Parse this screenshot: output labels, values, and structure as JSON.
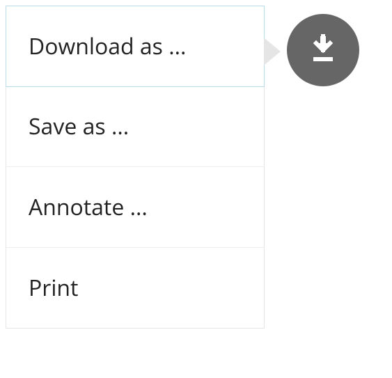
{
  "menu": {
    "items": [
      {
        "label": "Download as ..."
      },
      {
        "label": "Save as ..."
      },
      {
        "label": "Annotate ..."
      },
      {
        "label": "Print"
      }
    ]
  },
  "fab": {
    "icon": "download-icon",
    "color": "#666666"
  }
}
